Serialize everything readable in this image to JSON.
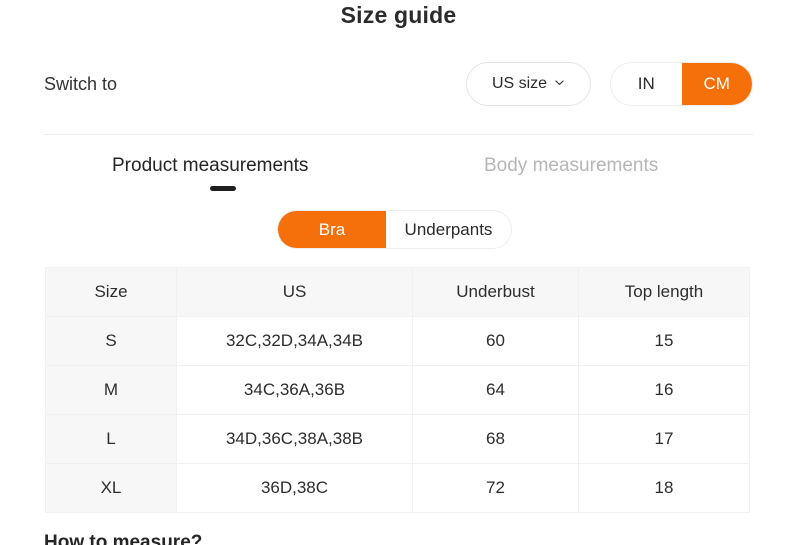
{
  "page": {
    "title": "Size guide",
    "bottom_note": "How to measure?"
  },
  "switch": {
    "label": "Switch to",
    "size_system": {
      "value": "US size",
      "icon": "chevron-down-icon"
    },
    "units": {
      "options": [
        "IN",
        "CM"
      ],
      "selected": "CM"
    }
  },
  "tabs": [
    {
      "label": "Product measurements",
      "active": true
    },
    {
      "label": "Body measurements",
      "active": false
    }
  ],
  "categories": {
    "options": [
      "Bra",
      "Underpants"
    ],
    "selected": "Bra"
  },
  "table": {
    "headers": [
      "Size",
      "US",
      "Underbust",
      "Top length"
    ],
    "rows": [
      [
        "S",
        "32C,32D,34A,34B",
        "60",
        "15"
      ],
      [
        "M",
        "34C,36A,36B",
        "64",
        "16"
      ],
      [
        "L",
        "34D,36C,38A,38B",
        "68",
        "17"
      ],
      [
        "XL",
        "36D,38C",
        "72",
        "18"
      ]
    ]
  },
  "colors": {
    "accent": "#f5700a",
    "text": "#2b2b2b",
    "muted": "#b6b6b6",
    "header_bg": "#f7f7f7",
    "border": "#f0f0f0"
  }
}
